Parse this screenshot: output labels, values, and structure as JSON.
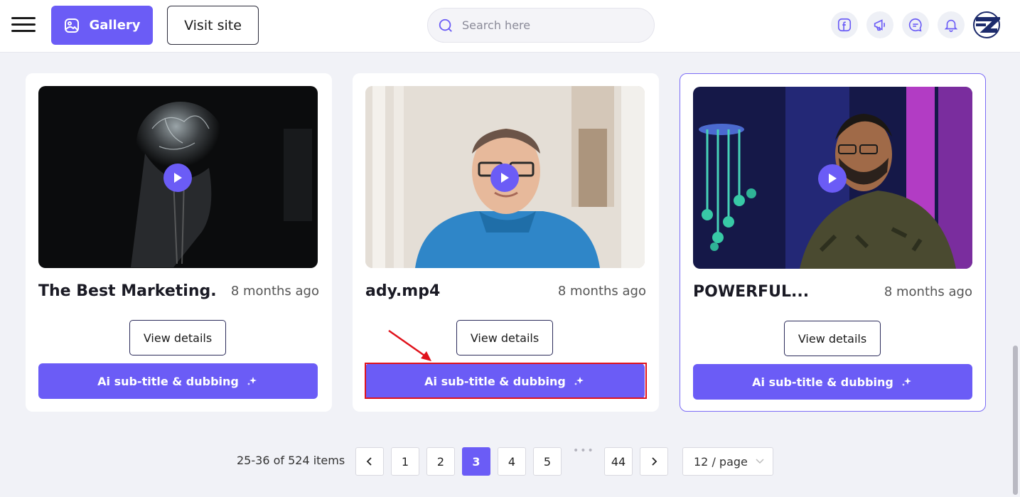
{
  "header": {
    "gallery_label": "Gallery",
    "visit_label": "Visit site",
    "search_placeholder": "Search here",
    "icons": [
      "facebook-icon",
      "megaphone-icon",
      "chat-icon",
      "bell-icon"
    ],
    "accent": "#6b5cf6"
  },
  "cards": [
    {
      "title": "The Best Marketing...",
      "time": "8 months ago",
      "view_label": "View details",
      "ai_label": "Ai sub-title & dubbing"
    },
    {
      "title": "ady.mp4",
      "time": "8 months ago",
      "view_label": "View details",
      "ai_label": "Ai sub-title & dubbing"
    },
    {
      "title": "POWERFUL...",
      "time": "8 months ago",
      "view_label": "View details",
      "ai_label": "Ai sub-title & dubbing"
    }
  ],
  "pagination": {
    "summary": "25-36 of 524 items",
    "prev": "<",
    "next": ">",
    "pages": [
      "1",
      "2",
      "3",
      "4",
      "5"
    ],
    "current": "3",
    "ellipsis": "•••",
    "last": "44",
    "page_size": "12 / page"
  }
}
